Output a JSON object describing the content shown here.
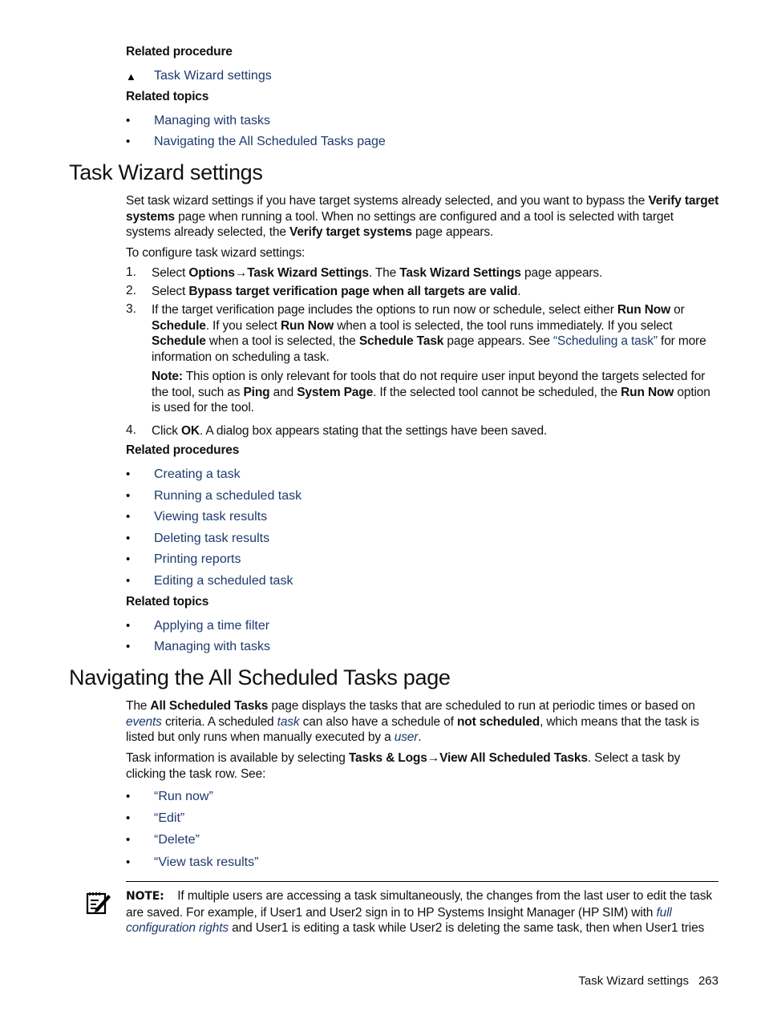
{
  "top_related": {
    "procedure_label": "Related procedure",
    "procedure_items": [
      "Task Wizard settings"
    ],
    "topics_label": "Related topics",
    "topics_items": [
      "Managing with tasks",
      "Navigating the All Scheduled Tasks page"
    ]
  },
  "section1": {
    "title": "Task Wizard settings",
    "intro": {
      "p1": "Set task wizard settings if you have target systems already selected, and you want to bypass the ",
      "b1": "Verify target systems",
      "p2": " page when running a tool. When no settings are configured and a tool is selected with target systems already selected, the ",
      "b2": "Verify target systems",
      "p3": " page appears."
    },
    "configure_lead": "To configure task wizard settings:",
    "steps": {
      "s1": {
        "num": "1.",
        "t1": "Select ",
        "b1": "Options",
        "arrow": "→",
        "b2": "Task Wizard Settings",
        "t2": ". The ",
        "b3": "Task Wizard Settings",
        "t3": " page appears."
      },
      "s2": {
        "num": "2.",
        "t1": "Select ",
        "b1": "Bypass target verification page when all targets are valid",
        "t2": "."
      },
      "s3": {
        "num": "3.",
        "t1": "If the target verification page includes the options to run now or schedule, select either ",
        "b1": "Run Now",
        "t2": " or ",
        "b2": "Schedule",
        "t3": ". If you select ",
        "b3": "Run Now",
        "t4": " when a tool is selected, the tool runs immediately. If you select ",
        "b4": "Schedule",
        "t5": " when a tool is selected, the ",
        "b5": "Schedule Task",
        "t6": " page appears. See ",
        "link": "“Scheduling a task”",
        "t7": " for more information on scheduling a task."
      },
      "note": {
        "label": "Note:",
        "t1": " This option is only relevant for tools that do not require user input beyond the targets selected for the tool, such as ",
        "b1": "Ping",
        "t2": " and ",
        "b2": "System Page",
        "t3": ". If the selected tool cannot be scheduled, the ",
        "b3": "Run Now",
        "t4": " option is used for the tool."
      },
      "s4": {
        "num": "4.",
        "t1": "Click ",
        "b1": "OK",
        "t2": ". A dialog box appears stating that the settings have been saved."
      }
    },
    "procedures_label": "Related procedures",
    "procedures": [
      "Creating a task",
      "Running a scheduled task",
      "Viewing task results",
      "Deleting task results",
      "Printing reports",
      "Editing a scheduled task"
    ],
    "topics_label": "Related topics",
    "topics": [
      "Applying a time filter",
      "Managing with tasks"
    ]
  },
  "section2": {
    "title": "Navigating the All Scheduled Tasks page",
    "p1": {
      "t1": "The ",
      "b1": "All Scheduled Tasks",
      "t2": " page displays the tasks that are scheduled to run at periodic times or based on ",
      "l1": "events",
      "t3": " criteria. A scheduled ",
      "l2": "task",
      "t4": " can also have a schedule of ",
      "b2": "not scheduled",
      "t5": ", which means that the task is listed but only runs when manually executed by a ",
      "l3": "user",
      "t6": "."
    },
    "p2": {
      "t1": "Task information is available by selecting ",
      "b1": "Tasks & Logs",
      "arrow": "→",
      "b2": "View All Scheduled Tasks",
      "t2": ". Select a task by clicking the task row. See:"
    },
    "see_links": [
      "“Run now”",
      "“Edit”",
      "“Delete”",
      "“View task results”"
    ]
  },
  "note": {
    "icon": "note-pencil-icon",
    "label": "NOTE:",
    "t1": "    If multiple users are accessing a task simultaneously, the changes from the last user to edit the task are saved. For example, if User1 and User2 sign in to HP Systems Insight Manager (HP SIM) with ",
    "l1": "full configuration rights",
    "t2": " and User1 is editing a task while User2 is deleting the same task, then when User1 tries"
  },
  "footer": {
    "section": "Task Wizard settings",
    "page": "263"
  }
}
